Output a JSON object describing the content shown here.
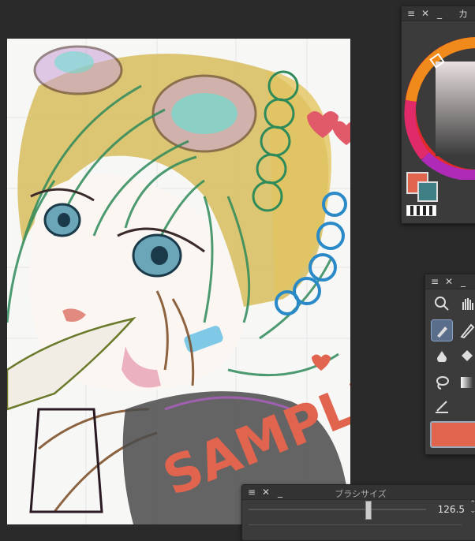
{
  "brush_size_panel": {
    "title": "ブラシサイズ",
    "value": "126.5"
  },
  "color_panel": {
    "title_fragment": "カ",
    "main_color": "#e0644e",
    "sub_color": "#3f7f86"
  },
  "tool_panel": {
    "tools": [
      "zoom-icon",
      "hand-icon",
      "pen-icon",
      "pencil-icon",
      "brush-icon",
      "fill-icon",
      "lasso-icon",
      "gradient-icon",
      "line-icon"
    ],
    "active_tool": "pen-icon"
  },
  "artwork": {
    "watermark": "SAMPLE"
  }
}
